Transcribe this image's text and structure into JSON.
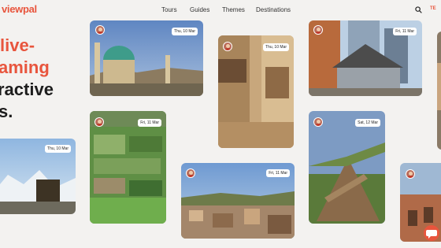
{
  "header": {
    "logo": "viewpal",
    "nav": [
      "Tours",
      "Guides",
      "Themes",
      "Destinations"
    ],
    "lang": "TE"
  },
  "hero": {
    "line1": "live-",
    "line2": "aming",
    "line3": "ractive",
    "line4": "s."
  },
  "cards": [
    {
      "id": "mosque",
      "date": "Thu, 10 Mar"
    },
    {
      "id": "alley",
      "date": "Thu, 10 Mar"
    },
    {
      "id": "station",
      "date": "Fri, 11 Mar"
    },
    {
      "id": "gardens",
      "date": "Fri, 11 Mar"
    },
    {
      "id": "palm",
      "date": "Sat, 12 Mar"
    },
    {
      "id": "alps",
      "date": "Thu, 10 Mar"
    },
    {
      "id": "town",
      "date": "Fri, 11 Mar"
    }
  ],
  "colors": {
    "accent": "#e8553d",
    "text": "#1d1d1d",
    "background": "#f3f2f0"
  },
  "icons": {
    "search": "search-icon",
    "chat": "chat-icon"
  }
}
